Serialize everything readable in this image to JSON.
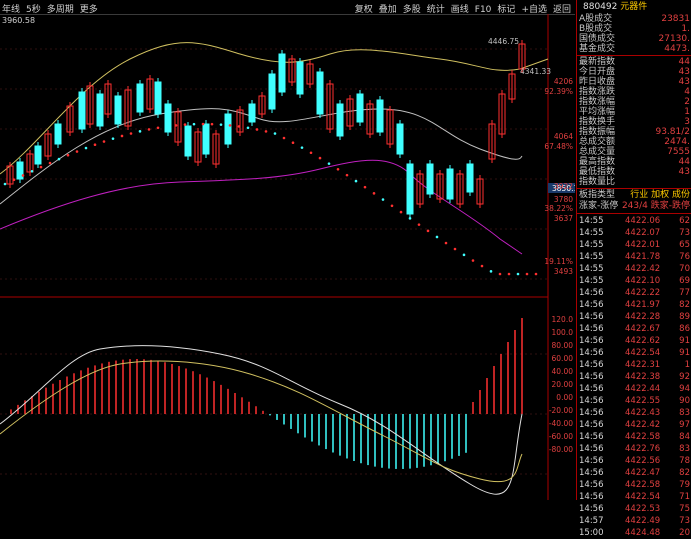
{
  "toolbar": {
    "left": [
      "年线",
      "5秒",
      "多周期",
      "更多"
    ],
    "right": [
      "复权",
      "叠加",
      "多股",
      "统计",
      "画线",
      "F10",
      "标记",
      "+自选",
      "返回"
    ]
  },
  "chart": {
    "price_readout": "3960.58",
    "label_top": "4446.75",
    "label_mid": "4341.33",
    "price_cursor": "3850.1",
    "axis_labels": [
      "4206",
      "92.39%",
      "4064",
      "67.48%",
      "3922",
      "3780",
      "38.22%",
      "3637",
      "19.11%",
      "3493"
    ],
    "macd_labels": [
      "120.0",
      "100.0",
      "80.00",
      "60.00",
      "40.00",
      "20.00",
      "0.00",
      "-20.00",
      "-40.00",
      "-60.00",
      "-80.00"
    ],
    "colors": {
      "up": "#ff3030",
      "down": "#40e0ff",
      "ma1": "#d0c060",
      "ma2": "#c0c0c0",
      "ma3": "#c020c0",
      "dot_down": "#40ffff"
    }
  },
  "panel": {
    "code": "880492",
    "name": "元器件",
    "stats": [
      {
        "label": "A股成交",
        "value": "23831"
      },
      {
        "label": "B股成交",
        "value": "1."
      },
      {
        "label": "国债成交",
        "value": "27130."
      },
      {
        "label": "基金成交",
        "value": "4473."
      }
    ],
    "index": [
      {
        "label": "最新指数",
        "value": "44"
      },
      {
        "label": "今日开盘",
        "value": "43"
      },
      {
        "label": "昨日收盘",
        "value": "43"
      },
      {
        "label": "指数涨跌",
        "value": "4"
      },
      {
        "label": "指数涨幅",
        "value": "2"
      },
      {
        "label": "平均涨幅",
        "value": "1"
      },
      {
        "label": "指数换手",
        "value": "3"
      },
      {
        "label": "指数振幅",
        "value": "93.81/2"
      },
      {
        "label": "总成交额",
        "value": "2474."
      },
      {
        "label": "总成交量",
        "value": "7555"
      },
      {
        "label": "最高指数",
        "value": "44"
      },
      {
        "label": "最低指数",
        "value": "43"
      },
      {
        "label": "指数量比",
        "value": ""
      }
    ],
    "sector_header": {
      "a": "板指类型",
      "b": "行业 加权 成份"
    },
    "sector_row": {
      "a": "涨家-涨停",
      "b": "243/4 跌家-跌停"
    },
    "ticks": [
      {
        "t": "14:55",
        "p": "4422.06",
        "v": "62"
      },
      {
        "t": "14:55",
        "p": "4422.07",
        "v": "73"
      },
      {
        "t": "14:55",
        "p": "4422.01",
        "v": "65"
      },
      {
        "t": "14:55",
        "p": "4421.78",
        "v": "76"
      },
      {
        "t": "14:55",
        "p": "4422.42",
        "v": "70"
      },
      {
        "t": "14:55",
        "p": "4422.10",
        "v": "69"
      },
      {
        "t": "14:56",
        "p": "4422.22",
        "v": "77"
      },
      {
        "t": "14:56",
        "p": "4421.97",
        "v": "82"
      },
      {
        "t": "14:56",
        "p": "4422.28",
        "v": "89"
      },
      {
        "t": "14:56",
        "p": "4422.67",
        "v": "86"
      },
      {
        "t": "14:56",
        "p": "4422.62",
        "v": "91"
      },
      {
        "t": "14:56",
        "p": "4422.54",
        "v": "91"
      },
      {
        "t": "14:56",
        "p": "4422.31",
        "v": "1"
      },
      {
        "t": "14:56",
        "p": "4422.38",
        "v": "92"
      },
      {
        "t": "14:56",
        "p": "4422.44",
        "v": "94"
      },
      {
        "t": "14:56",
        "p": "4422.55",
        "v": "90"
      },
      {
        "t": "14:56",
        "p": "4422.43",
        "v": "83"
      },
      {
        "t": "14:56",
        "p": "4422.42",
        "v": "97"
      },
      {
        "t": "14:56",
        "p": "4422.58",
        "v": "84"
      },
      {
        "t": "14:56",
        "p": "4422.76",
        "v": "83"
      },
      {
        "t": "14:56",
        "p": "4422.56",
        "v": "78"
      },
      {
        "t": "14:56",
        "p": "4422.47",
        "v": "82"
      },
      {
        "t": "14:56",
        "p": "4422.58",
        "v": "79"
      },
      {
        "t": "14:56",
        "p": "4422.54",
        "v": "71"
      },
      {
        "t": "14:56",
        "p": "4422.53",
        "v": "75"
      },
      {
        "t": "14:57",
        "p": "4422.49",
        "v": "73"
      },
      {
        "t": "15:00",
        "p": "4424.48",
        "v": "20"
      }
    ]
  }
}
